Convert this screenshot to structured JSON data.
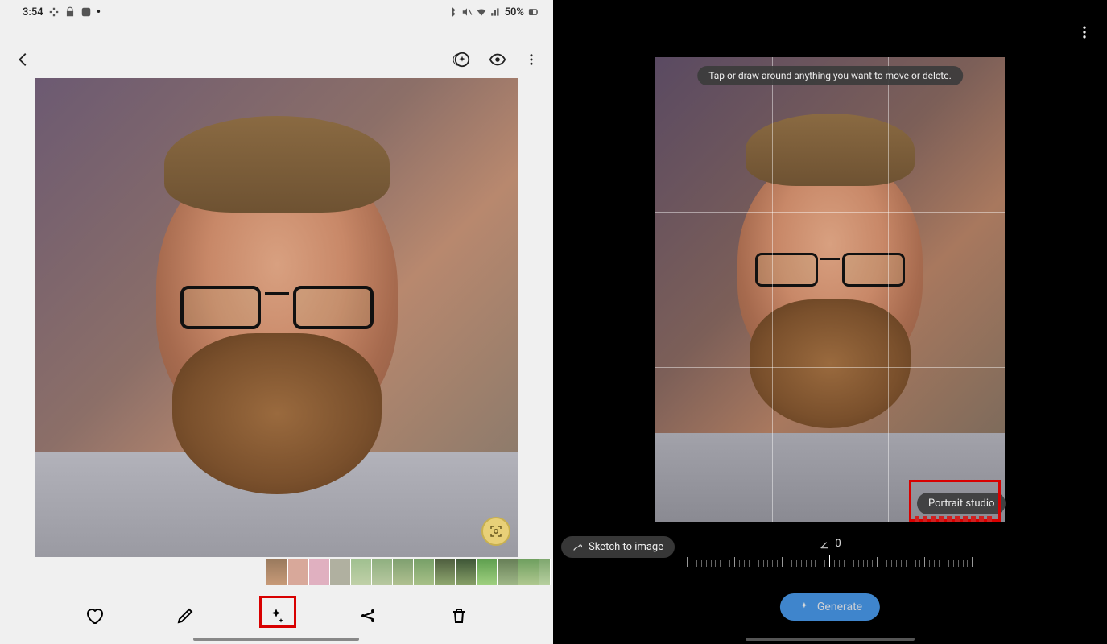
{
  "status_bar": {
    "time": "3:54",
    "battery": "50%"
  },
  "left": {
    "thumbnail_count": 14
  },
  "right": {
    "tooltip": "Tap or draw around anything you want to move or delete.",
    "sketch_pill": "Sketch to image",
    "portrait_pill": "Portrait studio",
    "angle_value": "0",
    "generate": "Generate"
  }
}
